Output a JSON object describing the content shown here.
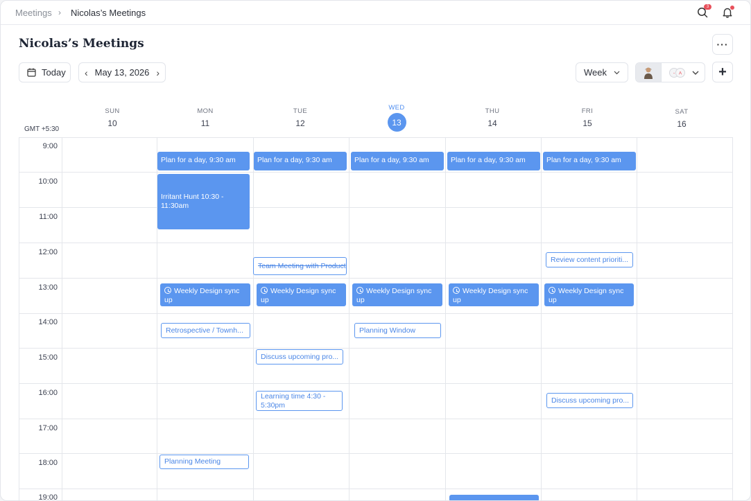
{
  "breadcrumb": {
    "parent": "Meetings",
    "current": "Nicolas’s Meetings"
  },
  "header": {
    "search_badge_count": "3",
    "title": "Nicolas’s Meetings",
    "more_label": "···"
  },
  "toolbar": {
    "today_label": "Today",
    "date_label": "May 13, 2026",
    "view_label": "Week"
  },
  "calendar": {
    "timezone": "GMT +5:30",
    "days": [
      {
        "name": "SUN",
        "num": "10"
      },
      {
        "name": "MON",
        "num": "11"
      },
      {
        "name": "TUE",
        "num": "12"
      },
      {
        "name": "WED",
        "num": "13"
      },
      {
        "name": "THU",
        "num": "14"
      },
      {
        "name": "FRI",
        "num": "15"
      },
      {
        "name": "SAT",
        "num": "16"
      }
    ],
    "hours": [
      "9:00",
      "10:00",
      "11:00",
      "12:00",
      "13:00",
      "14:00",
      "15:00",
      "16:00",
      "17:00",
      "18:00",
      "19:00"
    ],
    "events": {
      "plan": "Plan for a day, 9:30 am",
      "irritant": "Irritant Hunt 10:30 - 11:30am",
      "team_meeting": "Team Meeting with Product",
      "review": "Review content prioriti...",
      "weekly_sync": "Weekly Design sync up",
      "retro": "Retrospective / Townh...",
      "planning_window": "Planning Window",
      "discuss": "Discuss upcoming pro...",
      "learning": "Learning time 4:30 - 5:30pm",
      "planning_meeting": "Planning Meeting"
    }
  },
  "colors": {
    "accent": "#5b96ef",
    "badge": "#e8505b"
  }
}
